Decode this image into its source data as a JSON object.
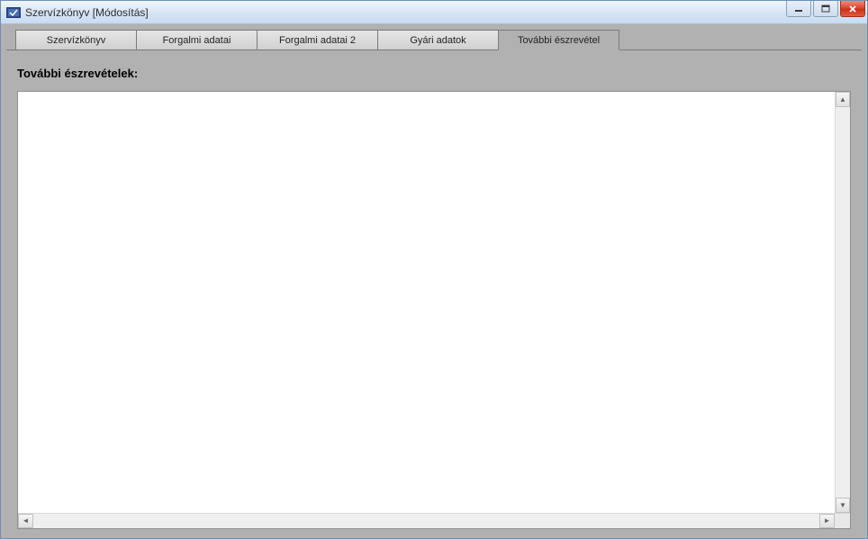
{
  "window": {
    "title": "Szervízkönyv [Módosítás]"
  },
  "tabs": [
    {
      "label": "Szervízkönyv",
      "active": false
    },
    {
      "label": "Forgalmi adatai",
      "active": false
    },
    {
      "label": "Forgalmi adatai 2",
      "active": false
    },
    {
      "label": "Gyári adatok",
      "active": false
    },
    {
      "label": "További észrevétel",
      "active": true
    }
  ],
  "panel": {
    "section_label": "További észrevételek:",
    "textarea_value": ""
  }
}
